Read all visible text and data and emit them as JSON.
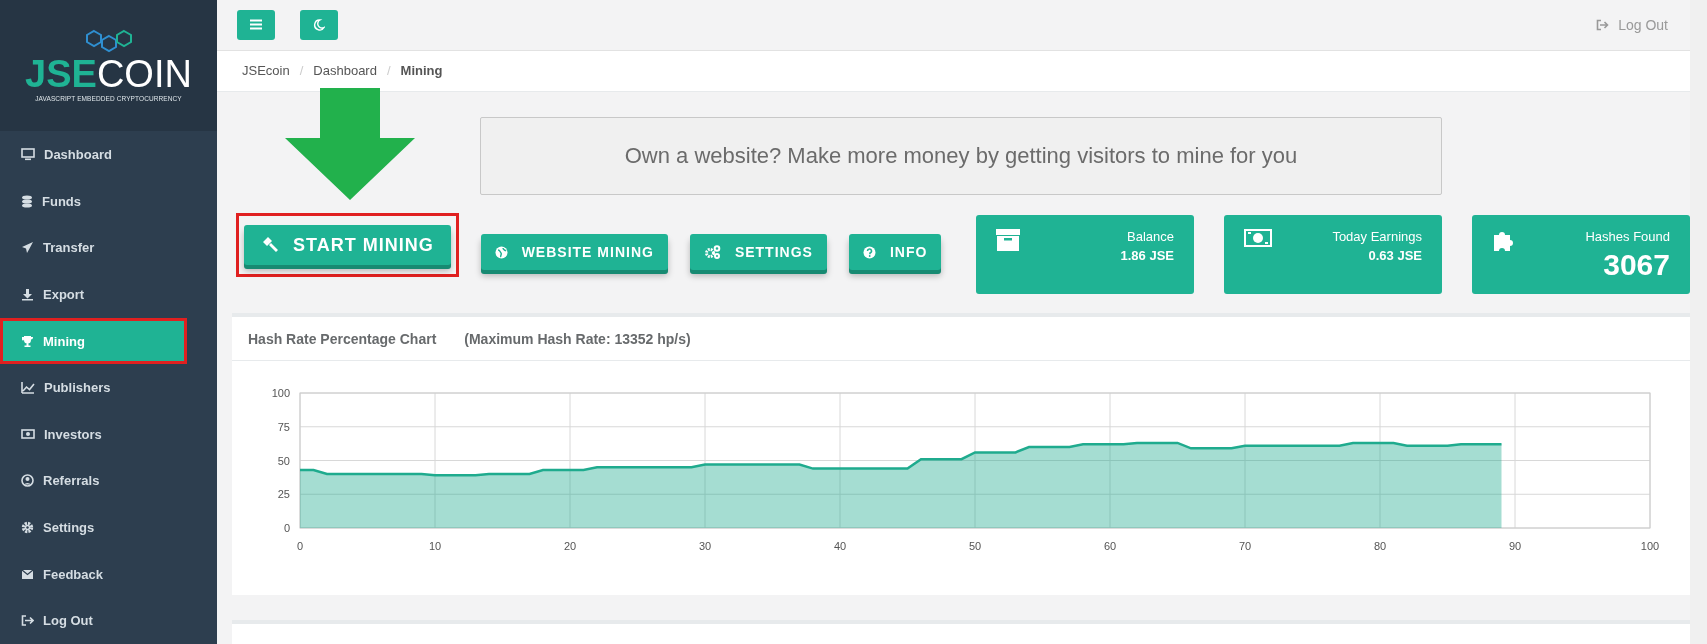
{
  "sidebar": {
    "logo": {
      "bold": "JSE",
      "light": "COIN",
      "tagline": "JAVASCRIPT EMBEDDED CRYPTOCURRENCY"
    },
    "items": [
      {
        "label": "Dashboard",
        "selected": false,
        "highlighted": false
      },
      {
        "label": "Funds",
        "selected": false,
        "highlighted": false
      },
      {
        "label": "Transfer",
        "selected": false,
        "highlighted": false
      },
      {
        "label": "Export",
        "selected": false,
        "highlighted": false
      },
      {
        "label": "Mining",
        "selected": true,
        "highlighted": true
      },
      {
        "label": "Publishers",
        "selected": false,
        "highlighted": false
      },
      {
        "label": "Investors",
        "selected": false,
        "highlighted": false
      },
      {
        "label": "Referrals",
        "selected": false,
        "highlighted": false
      },
      {
        "label": "Settings",
        "selected": false,
        "highlighted": false
      },
      {
        "label": "Feedback",
        "selected": false,
        "highlighted": false
      },
      {
        "label": "Log Out",
        "selected": false,
        "highlighted": false
      }
    ]
  },
  "topbar": {
    "logout": "Log Out"
  },
  "breadcrumb": [
    {
      "label": "JSEcoin",
      "current": false
    },
    {
      "label": "Dashboard",
      "current": false
    },
    {
      "label": "Mining",
      "current": true
    }
  ],
  "breadcrumb_separators": [
    "/",
    "/"
  ],
  "banner": "Own a website? Make more money by getting visitors to mine for you",
  "actions": [
    {
      "label": "START MINING",
      "kind": "primary",
      "highlighted": true
    },
    {
      "label": "WEBSITE MINING",
      "kind": "secondary",
      "highlighted": false
    },
    {
      "label": "SETTINGS",
      "kind": "secondary",
      "highlighted": false
    },
    {
      "label": "INFO",
      "kind": "secondary",
      "highlighted": false
    }
  ],
  "stats": [
    {
      "label": "Balance",
      "value": "1.86 JSE",
      "kind": "small"
    },
    {
      "label": "Today Earnings",
      "value": "0.63 JSE",
      "kind": "small"
    },
    {
      "label": "Hashes Found",
      "value": "3067",
      "kind": "large"
    }
  ],
  "chart_panel": {
    "title": "Hash Rate Percentage Chart",
    "subtitle": "(Maximum Hash Rate: 13352 hp/s)",
    "chart_data": {
      "type": "area",
      "x": [
        0,
        1,
        2,
        9,
        10,
        13,
        14,
        17,
        18,
        21,
        22,
        29,
        30,
        37,
        38,
        45,
        46,
        49,
        50,
        53,
        54,
        57,
        58,
        61,
        62,
        65,
        66,
        69,
        70,
        77,
        78,
        81,
        82,
        85,
        86,
        89
      ],
      "series": [
        {
          "color": "#1fab8e",
          "values": [
            43,
            43,
            40,
            40,
            39,
            39,
            40,
            40,
            43,
            43,
            45,
            45,
            47,
            47,
            44,
            44,
            51,
            51,
            56,
            56,
            60,
            60,
            62,
            62,
            63,
            63,
            59,
            59,
            61,
            61,
            63,
            63,
            61,
            61,
            62,
            62
          ]
        }
      ],
      "grid": true,
      "xlim": [
        0,
        100
      ],
      "ylim": [
        0,
        100
      ],
      "xticks": [
        0,
        10,
        20,
        30,
        40,
        50,
        60,
        70,
        80,
        90,
        100
      ],
      "yticks": [
        0,
        25,
        50,
        75,
        100
      ]
    }
  }
}
